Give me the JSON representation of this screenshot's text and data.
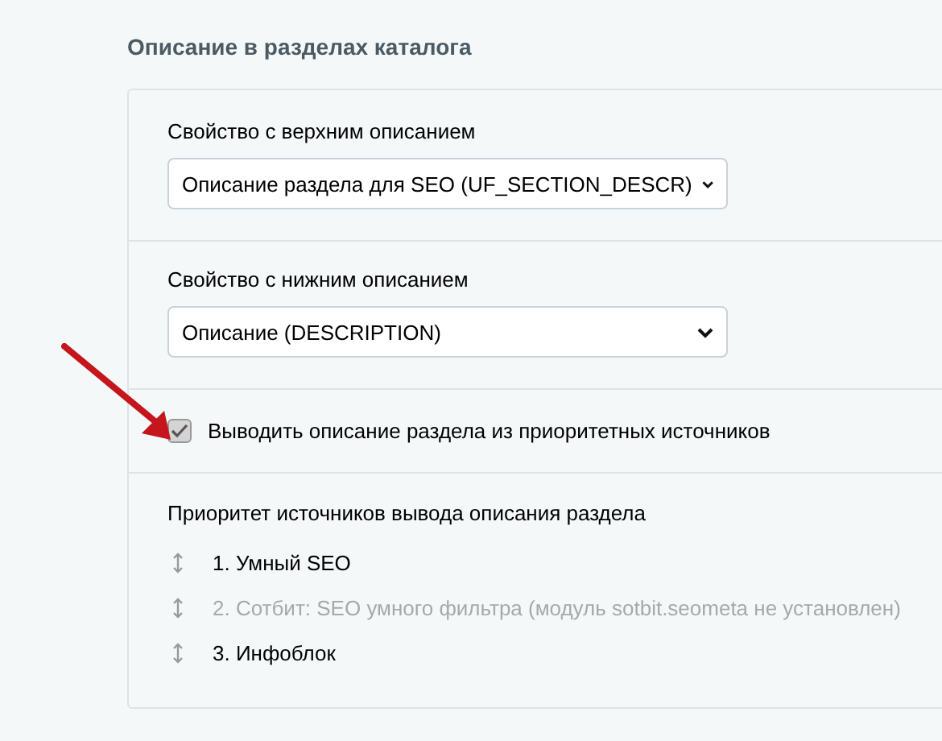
{
  "section_title": "Описание в разделах каталога",
  "fields": [
    {
      "label": "Свойство с верхним описанием",
      "value": "Описание раздела для SEO (UF_SECTION_DESCR)"
    },
    {
      "label": "Свойство с нижним описанием",
      "value": "Описание (DESCRIPTION)"
    }
  ],
  "checkbox": {
    "label": "Выводить описание раздела из приоритетных источников",
    "checked": true
  },
  "priority": {
    "label": "Приоритет источников вывода описания раздела",
    "items": [
      {
        "label": "1. Умный SEO",
        "disabled": false
      },
      {
        "label": "2. Сотбит: SEO умного фильтра (модуль sotbit.seometa не установлен)",
        "disabled": true
      },
      {
        "label": "3. Инфоблок",
        "disabled": false
      }
    ]
  }
}
